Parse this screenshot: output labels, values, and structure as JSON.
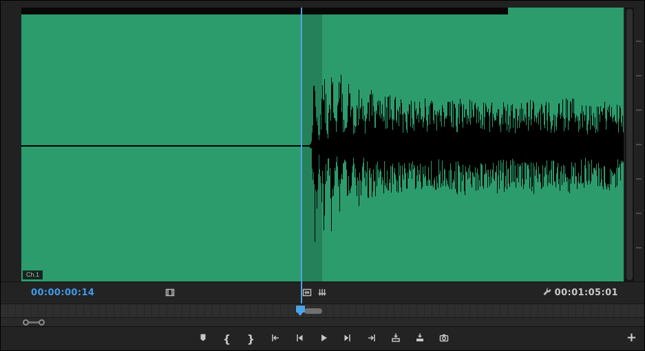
{
  "monitor": {
    "channel_label": "Ch.1",
    "current_timecode": "00:00:00:14",
    "duration_timecode": "00:01:05:01"
  },
  "glyphs": {
    "mark_in": "{",
    "mark_out": "}",
    "plus": "+"
  },
  "colors": {
    "clip_green": "#2c9c6d",
    "playhead_blue": "#4da3e8",
    "timecode_blue": "#3f9bea",
    "timecode_gray": "#c9c9c9"
  },
  "waveform": {
    "envelope": [
      [
        0,
        0
      ],
      [
        0.477,
        0
      ],
      [
        0.481,
        0.05
      ],
      [
        0.4875,
        1.0
      ],
      [
        0.494,
        0.12
      ],
      [
        0.501,
        0.95
      ],
      [
        0.508,
        0.18
      ],
      [
        0.515,
        0.88
      ],
      [
        0.522,
        0.2
      ],
      [
        0.529,
        0.8
      ],
      [
        0.536,
        0.26
      ],
      [
        0.544,
        0.7
      ],
      [
        0.552,
        0.3
      ],
      [
        0.56,
        0.62
      ],
      [
        0.568,
        0.34
      ],
      [
        0.578,
        0.55
      ],
      [
        0.59,
        0.45
      ],
      [
        0.61,
        0.48
      ],
      [
        0.64,
        0.41
      ],
      [
        0.67,
        0.47
      ],
      [
        0.7,
        0.4
      ],
      [
        0.73,
        0.47
      ],
      [
        0.76,
        0.41
      ],
      [
        0.79,
        0.46
      ],
      [
        0.82,
        0.39
      ],
      [
        0.85,
        0.45
      ],
      [
        0.88,
        0.4
      ],
      [
        0.91,
        0.46
      ],
      [
        0.94,
        0.38
      ],
      [
        0.97,
        0.43
      ],
      [
        1,
        0.36
      ]
    ]
  }
}
